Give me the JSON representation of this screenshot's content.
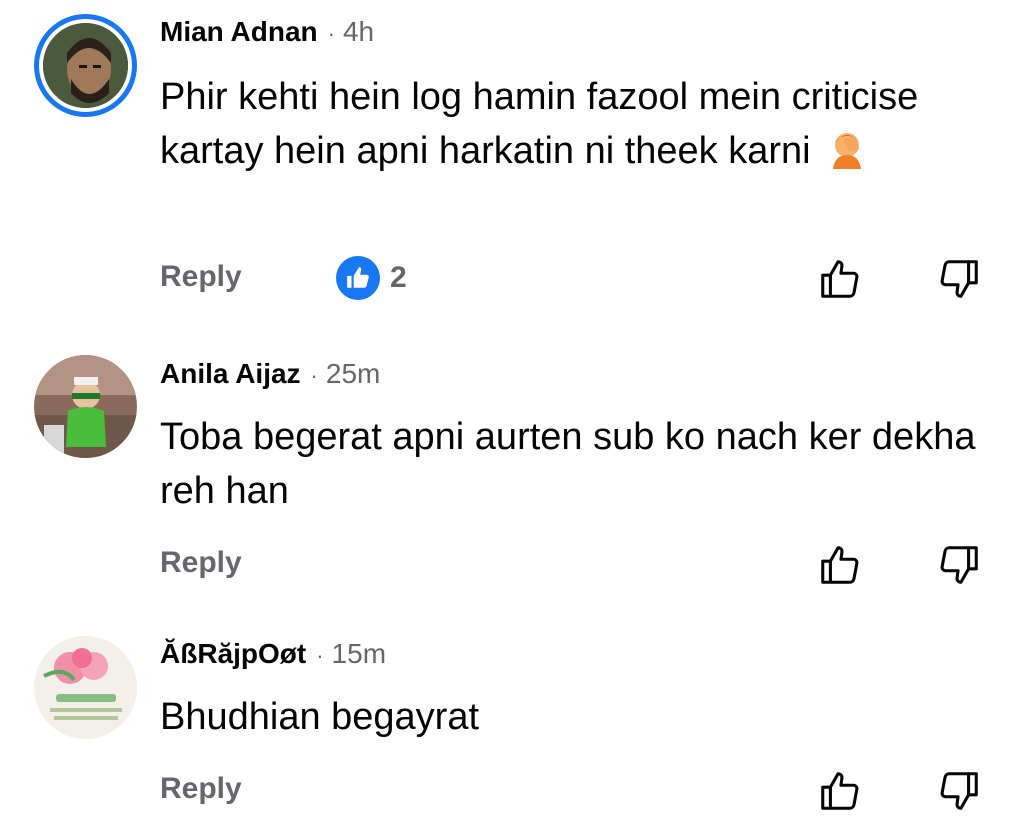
{
  "comments": [
    {
      "author": "Mian Adnan",
      "separator": "·",
      "time": "4h",
      "text": "Phir kehti hein log hamin fazool mein criticise kartay hein apni harkatin ni theek karni",
      "emoji": "face-palm-emoji",
      "reply_label": "Reply",
      "reaction_count": "2",
      "avatar_ring": true
    },
    {
      "author": "Anila Aijaz",
      "separator": "·",
      "time": "25m",
      "text": "Toba begerat apni aurten sub ko nach ker dekha reh han",
      "reply_label": "Reply"
    },
    {
      "author": "ĂßRăjpOøt",
      "separator": "·",
      "time": "15m",
      "text": "Bhudhian begayrat",
      "reply_label": "Reply"
    }
  ],
  "colors": {
    "accent": "#1877f2",
    "secondary_text": "#65676b",
    "primary_text": "#050505"
  },
  "icons": [
    "like-reaction-icon",
    "thumbs-up-icon",
    "thumbs-down-icon"
  ]
}
